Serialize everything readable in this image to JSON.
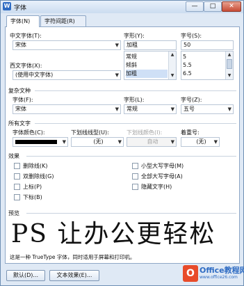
{
  "window": {
    "title": "字体",
    "icon_letter": "W",
    "minimize": "—",
    "maximize": "□",
    "close": "✕"
  },
  "tabs": [
    {
      "label": "字体(N)"
    },
    {
      "label": "字符间距(R)"
    }
  ],
  "font": {
    "chinese_label": "中文字体(T):",
    "chinese_value": "宋体",
    "western_label": "西文字体(X):",
    "western_value": "(使用中文字体)",
    "style_label": "字形(Y):",
    "style_value": "加粗",
    "style_options": [
      "常规",
      "倾斜",
      "加粗"
    ],
    "style_selected": 2,
    "size_label": "字号(S):",
    "size_value": "50",
    "size_options": [
      "5",
      "5.5",
      "6.5"
    ]
  },
  "complex": {
    "section": "复杂文种",
    "font_label": "字体(F):",
    "font_value": "宋体",
    "style_label": "字形(L):",
    "style_value": "常规",
    "size_label": "字号(Z):",
    "size_value": "五号"
  },
  "all_text": {
    "section": "所有文字",
    "color_label": "字体颜色(C):",
    "underline_label": "下划线线型(U):",
    "underline_value": "(无)",
    "underline_color_label": "下划线颜色(I):",
    "underline_color_value": "自动",
    "emphasis_label": "着重号:",
    "emphasis_value": "(无)"
  },
  "effects": {
    "section": "效果",
    "left": [
      {
        "label": "删除线(K)"
      },
      {
        "label": "双删除线(G)"
      },
      {
        "label": "上标(P)"
      },
      {
        "label": "下标(B)"
      }
    ],
    "right": [
      {
        "label": "小型大写字母(M)"
      },
      {
        "label": "全部大写字母(A)"
      },
      {
        "label": "隐藏文字(H)"
      }
    ]
  },
  "preview": {
    "section": "预览",
    "sample": "PS 让办公更轻松",
    "note": "这是一种 TrueType 字体，同时适用于屏幕和打印机。"
  },
  "buttons": {
    "default": "默认(D)...",
    "text_effects": "文本效果(E)..."
  },
  "watermark": {
    "line1": "Office教程网",
    "line2": "www.office26.com"
  },
  "colors": {
    "accent": "#2f6cc3",
    "border": "#8ea7c6",
    "font_color": "#000000"
  }
}
